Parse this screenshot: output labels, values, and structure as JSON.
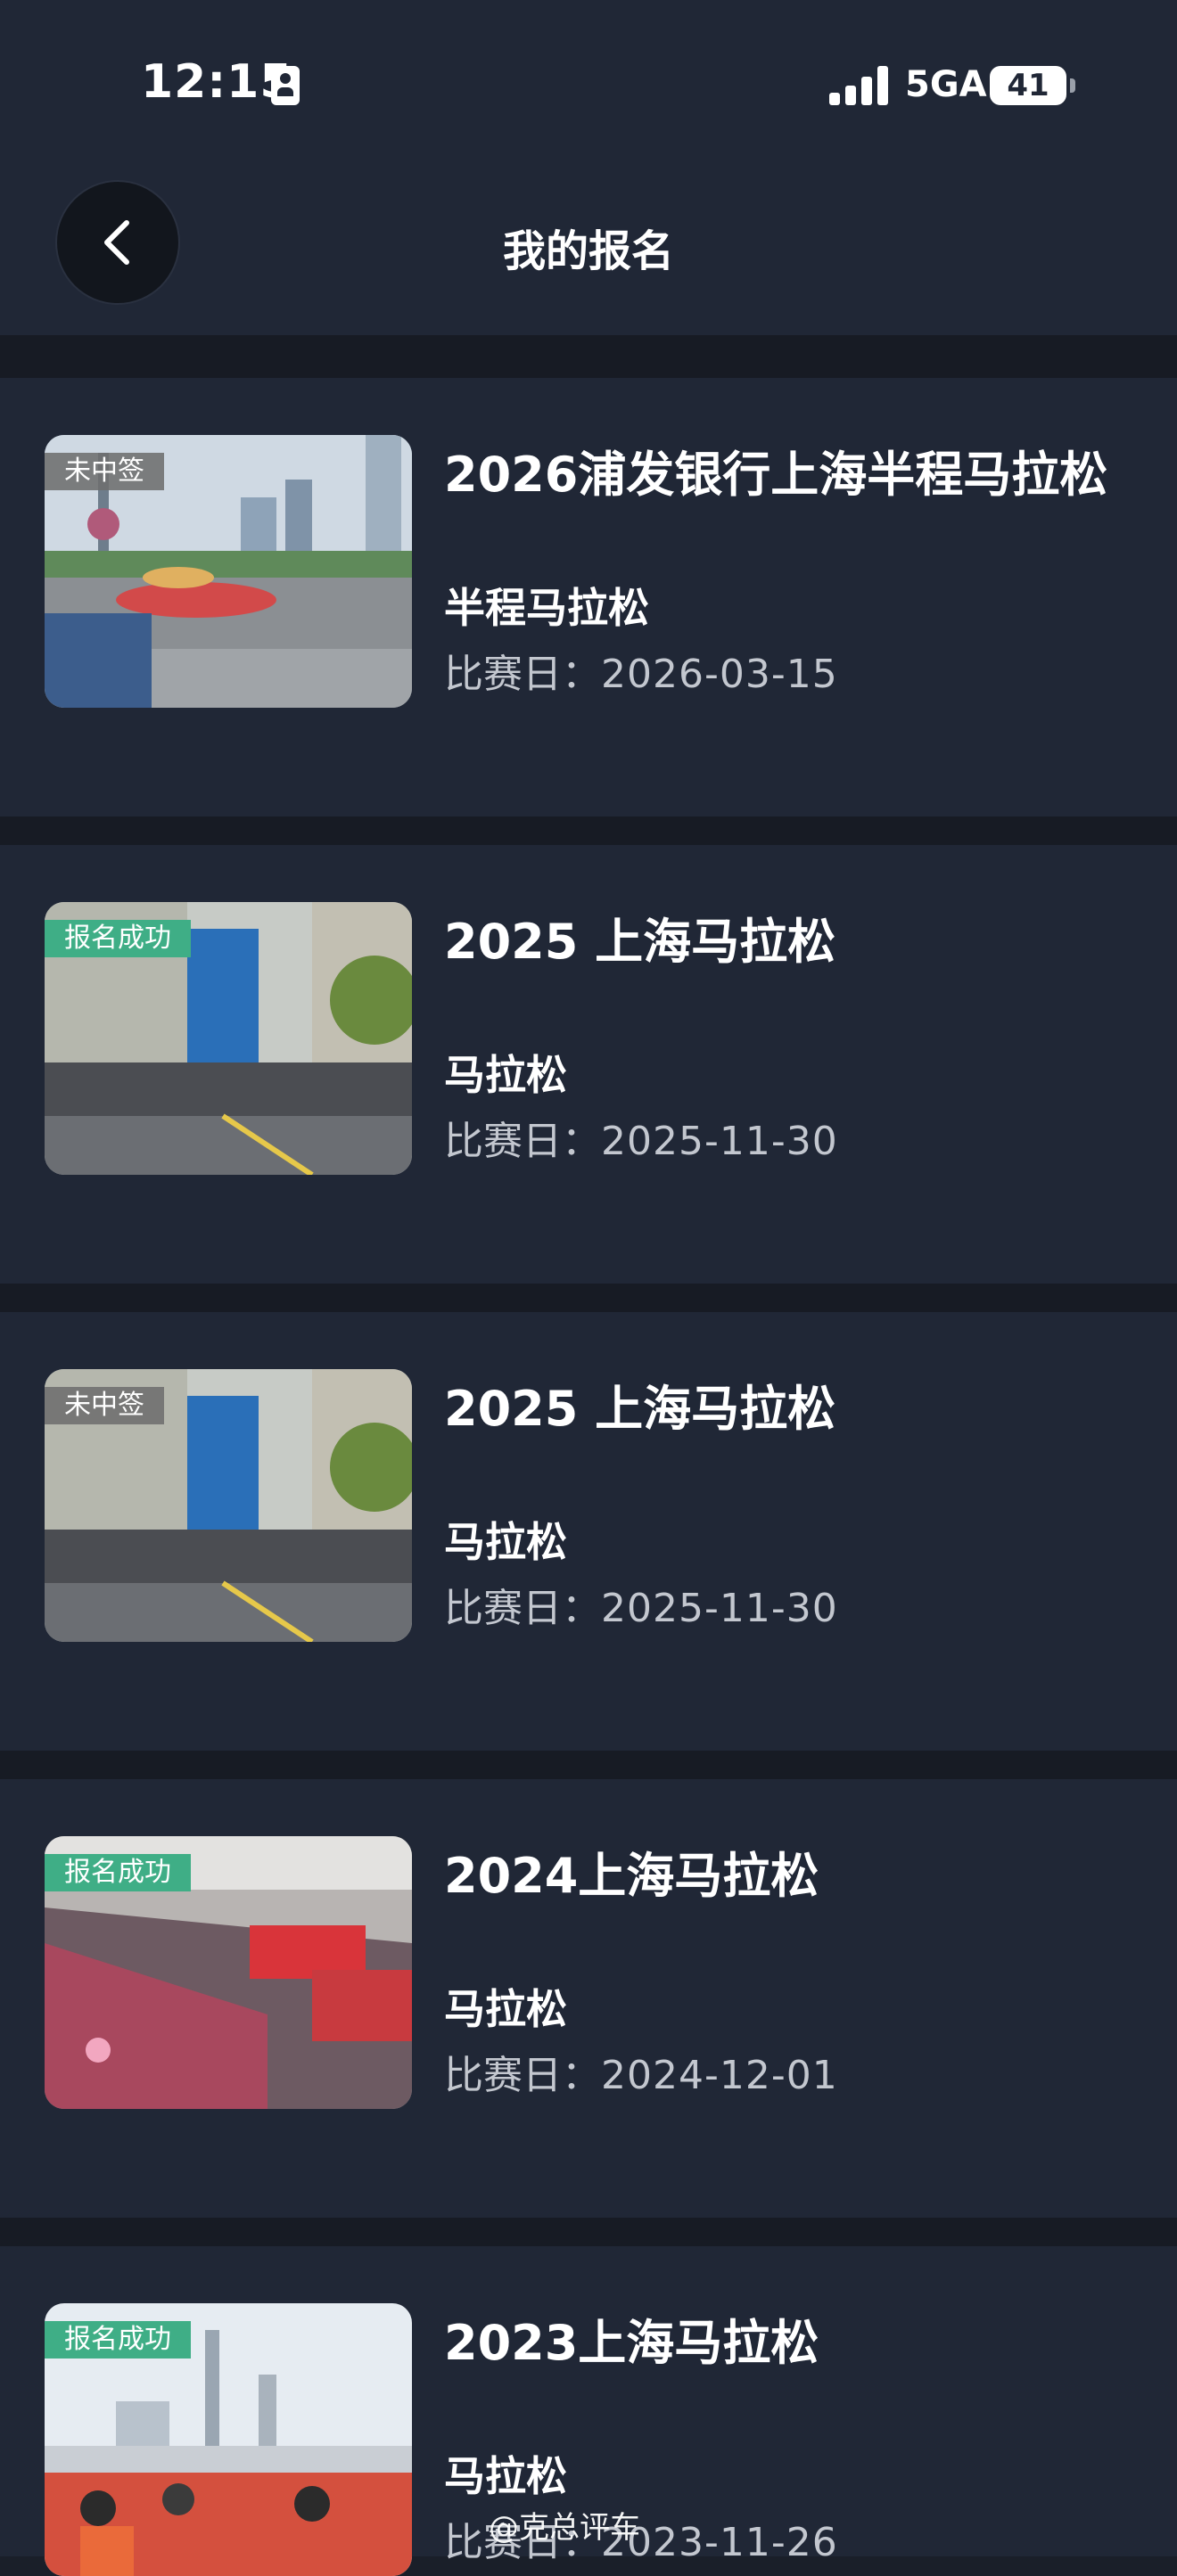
{
  "status": {
    "time": "12:15",
    "network": "5GA",
    "battery": "41"
  },
  "header": {
    "title": "我的报名"
  },
  "registrations": [
    {
      "title": "2026浦发银行上海半程马拉松",
      "type": "半程马拉松",
      "date_label": "比赛日：",
      "date": "2026-03-15",
      "status": "未中签",
      "status_kind": "fail"
    },
    {
      "title": "2025 上海马拉松",
      "type": "马拉松",
      "date_label": "比赛日：",
      "date": "2025-11-30",
      "status": "报名成功",
      "status_kind": "ok"
    },
    {
      "title": "2025 上海马拉松",
      "type": "马拉松",
      "date_label": "比赛日：",
      "date": "2025-11-30",
      "status": "未中签",
      "status_kind": "fail"
    },
    {
      "title": "2024上海马拉松",
      "type": "马拉松",
      "date_label": "比赛日：",
      "date": "2024-12-01",
      "status": "报名成功",
      "status_kind": "ok"
    },
    {
      "title": "2023上海马拉松",
      "type": "马拉松",
      "date_label": "比赛日：",
      "date": "2023-11-26",
      "status": "报名成功",
      "status_kind": "ok"
    }
  ],
  "watermark": "@克总评车",
  "colors": {
    "background": "#202736",
    "status_ok": "#3fae86",
    "status_fail": "#6e6e6e"
  }
}
